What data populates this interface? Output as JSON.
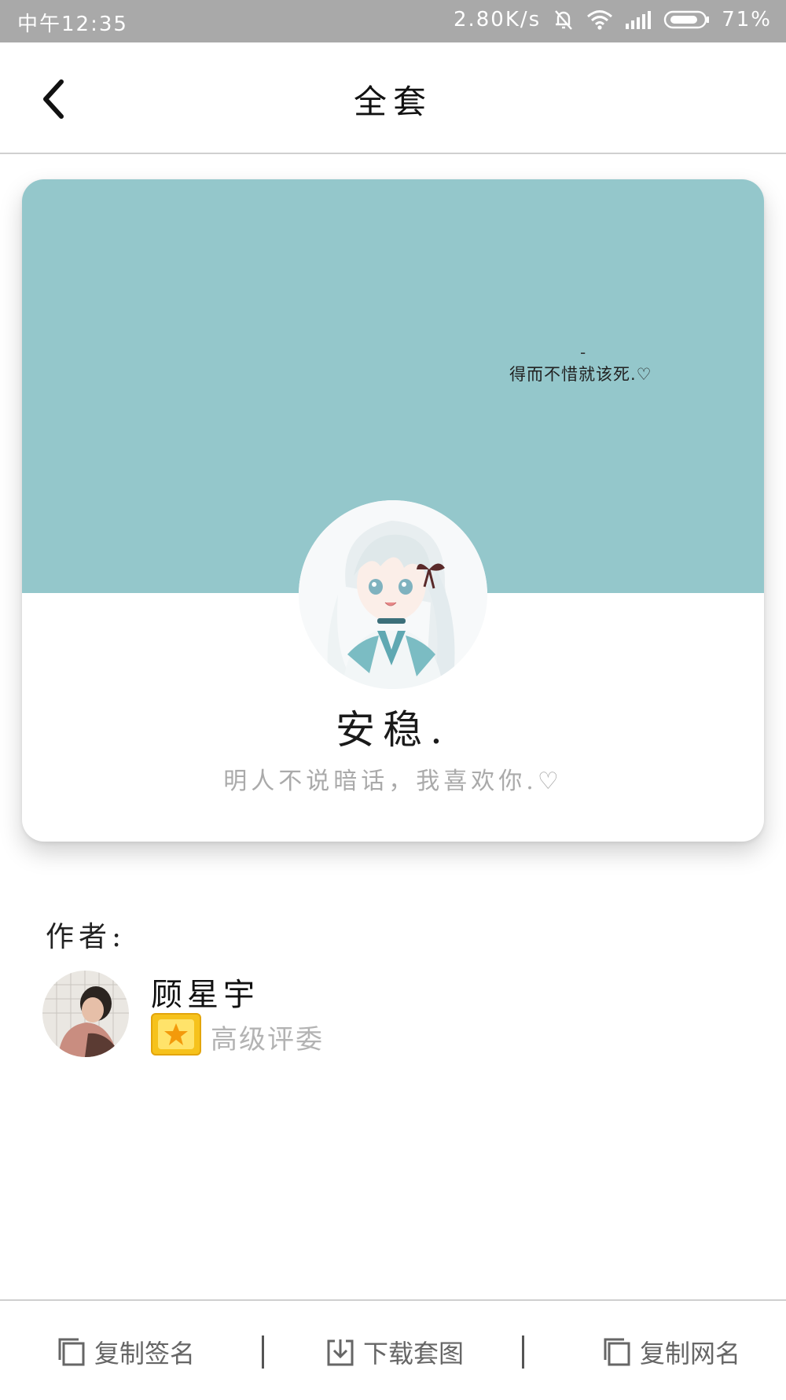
{
  "status_bar": {
    "time": "中午12:35",
    "network_speed": "2.80K/s",
    "battery": "71%"
  },
  "header": {
    "title": "全套"
  },
  "card": {
    "cover_dash": "-",
    "cover_quote": "得而不惜就该死.♡",
    "cover_color": "#94c7cb",
    "nickname": "安稳.",
    "signature": "明人不说暗话，我喜欢你.♡"
  },
  "author": {
    "label": "作者:",
    "name": "顾星宇",
    "role": "高级评委",
    "badge_color": "#f6c21c"
  },
  "bottom_bar": {
    "copy_signature": "复制签名",
    "download_images": "下载套图",
    "copy_name": "复制网名"
  }
}
